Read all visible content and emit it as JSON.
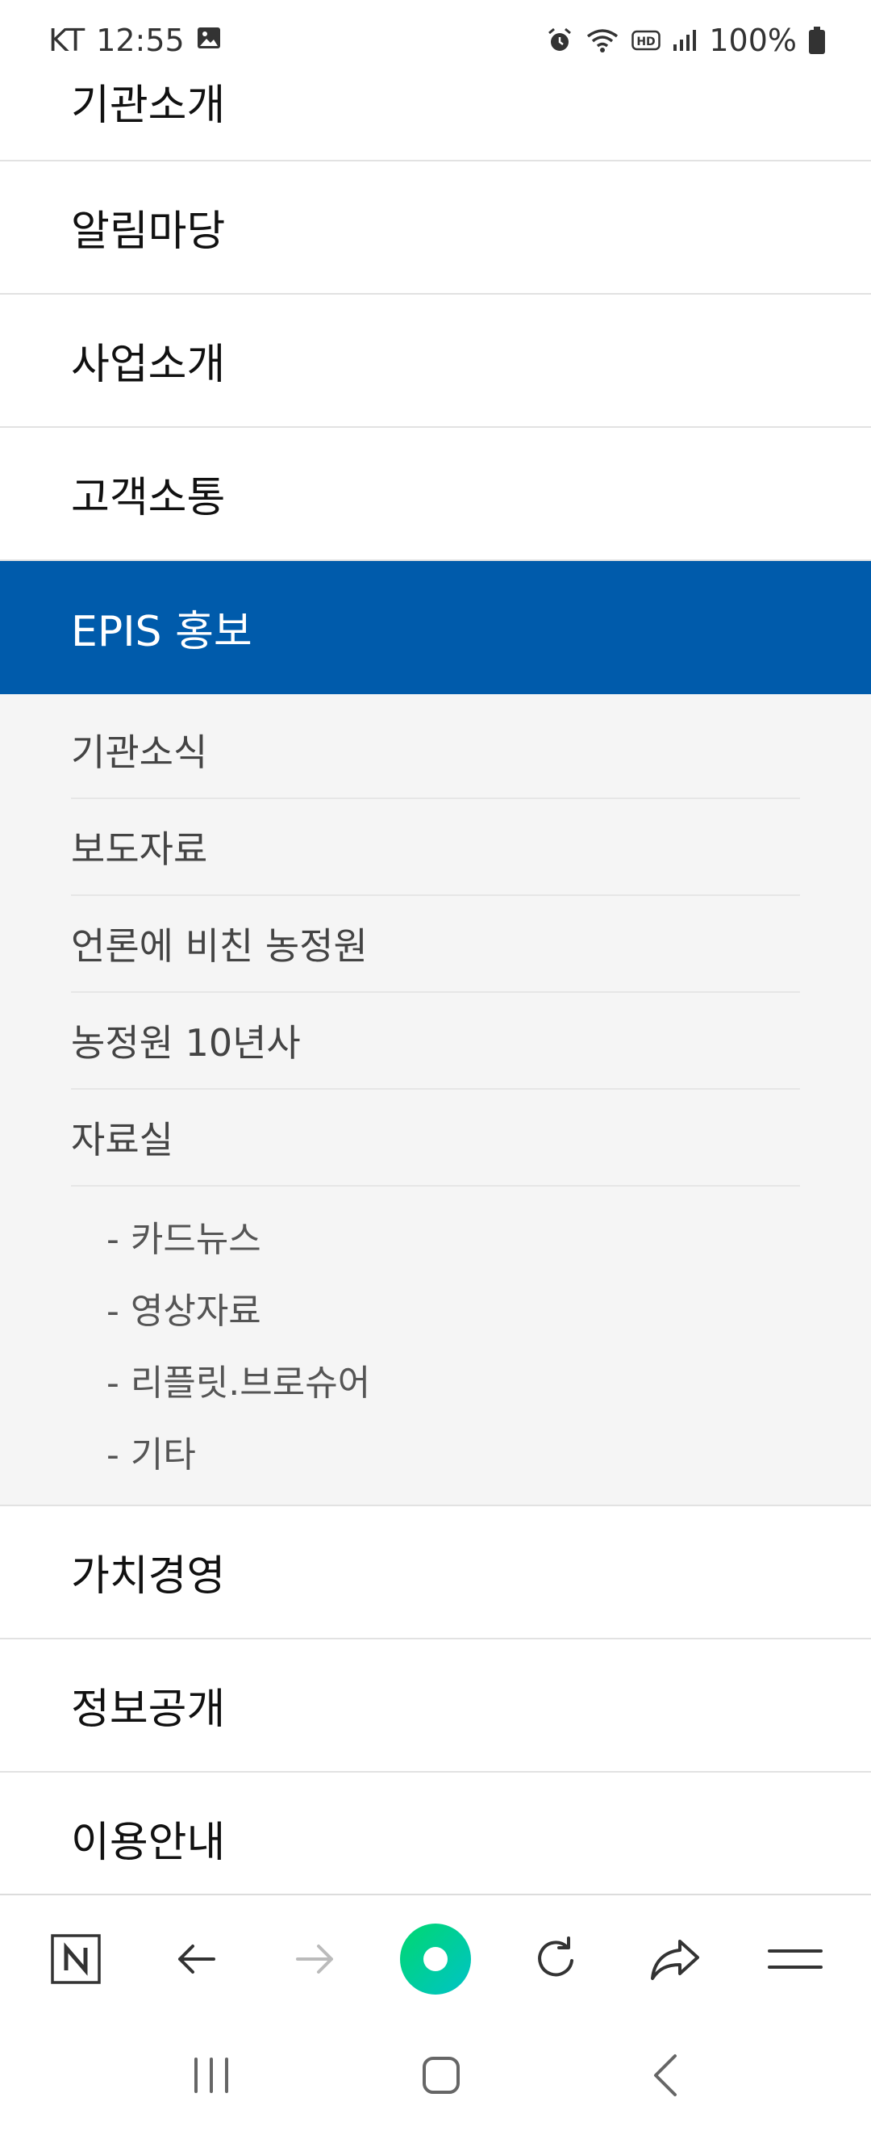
{
  "status_bar": {
    "carrier": "KT",
    "time": "12:55",
    "battery": "100%"
  },
  "menu": {
    "items_top": [
      {
        "label": "기관소개"
      },
      {
        "label": "알림마당"
      },
      {
        "label": "사업소개"
      },
      {
        "label": "고객소통"
      }
    ],
    "active_item": {
      "label": "EPIS 홍보"
    },
    "submenu": [
      {
        "label": "기관소식"
      },
      {
        "label": "보도자료"
      },
      {
        "label": "언론에 비친 농정원"
      },
      {
        "label": "농정원 10년사"
      },
      {
        "label": "자료실"
      }
    ],
    "subsubmenu": [
      {
        "label": "- 카드뉴스"
      },
      {
        "label": "- 영상자료"
      },
      {
        "label": "- 리플릿.브로슈어"
      },
      {
        "label": "- 기타"
      }
    ],
    "items_bottom": [
      {
        "label": "가치경영"
      },
      {
        "label": "정보공개"
      },
      {
        "label": "이용안내"
      }
    ]
  },
  "toolbar": {
    "icons": [
      "naver-n-icon",
      "back-arrow-icon",
      "forward-arrow-icon",
      "green-dot-icon",
      "refresh-icon",
      "share-icon",
      "menu-icon"
    ]
  },
  "colors": {
    "active_bg": "#005bab",
    "green": "#03c75a"
  }
}
